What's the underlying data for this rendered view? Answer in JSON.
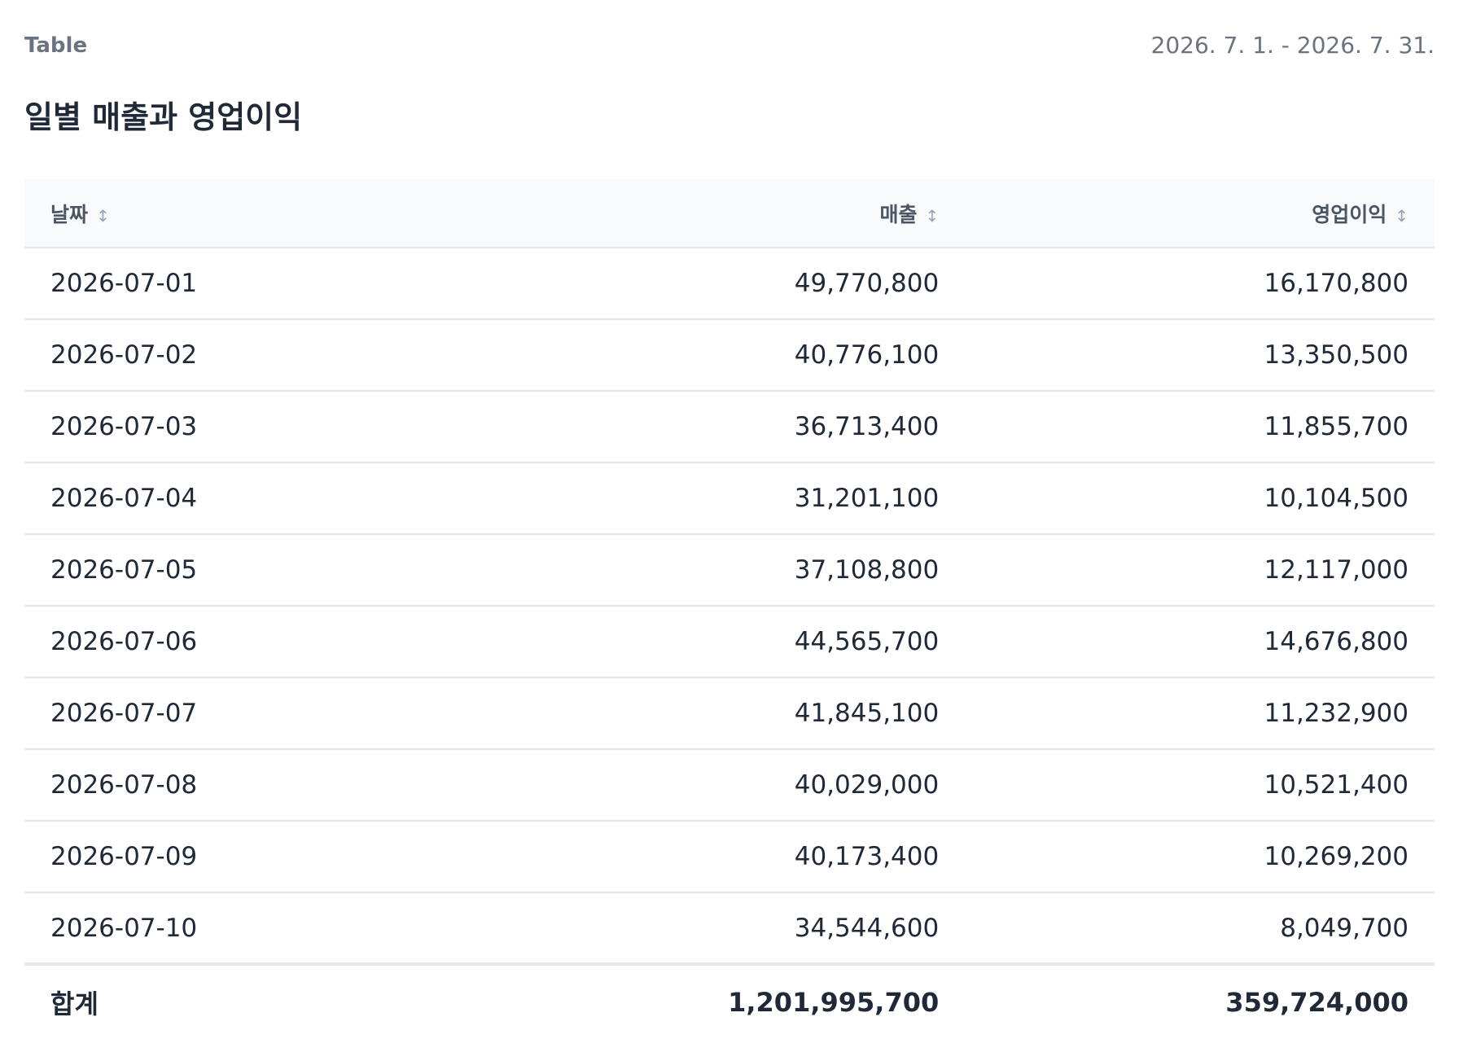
{
  "header": {
    "eyebrow": "Table",
    "date_range": "2026. 7. 1. - 2026. 7. 31.",
    "title": "일별 매출과 영업이익"
  },
  "icons": {
    "sort": "↕"
  },
  "chart_data": {
    "type": "table",
    "columns": [
      "날짜",
      "매출",
      "영업이익"
    ],
    "rows": [
      [
        "2026-07-01",
        "49,770,800",
        "16,170,800"
      ],
      [
        "2026-07-02",
        "40,776,100",
        "13,350,500"
      ],
      [
        "2026-07-03",
        "36,713,400",
        "11,855,700"
      ],
      [
        "2026-07-04",
        "31,201,100",
        "10,104,500"
      ],
      [
        "2026-07-05",
        "37,108,800",
        "12,117,000"
      ],
      [
        "2026-07-06",
        "44,565,700",
        "14,676,800"
      ],
      [
        "2026-07-07",
        "41,845,100",
        "11,232,900"
      ],
      [
        "2026-07-08",
        "40,029,000",
        "10,521,400"
      ],
      [
        "2026-07-09",
        "40,173,400",
        "10,269,200"
      ],
      [
        "2026-07-10",
        "34,544,600",
        "8,049,700"
      ]
    ],
    "footer": [
      "합계",
      "1,201,995,700",
      "359,724,000"
    ]
  }
}
